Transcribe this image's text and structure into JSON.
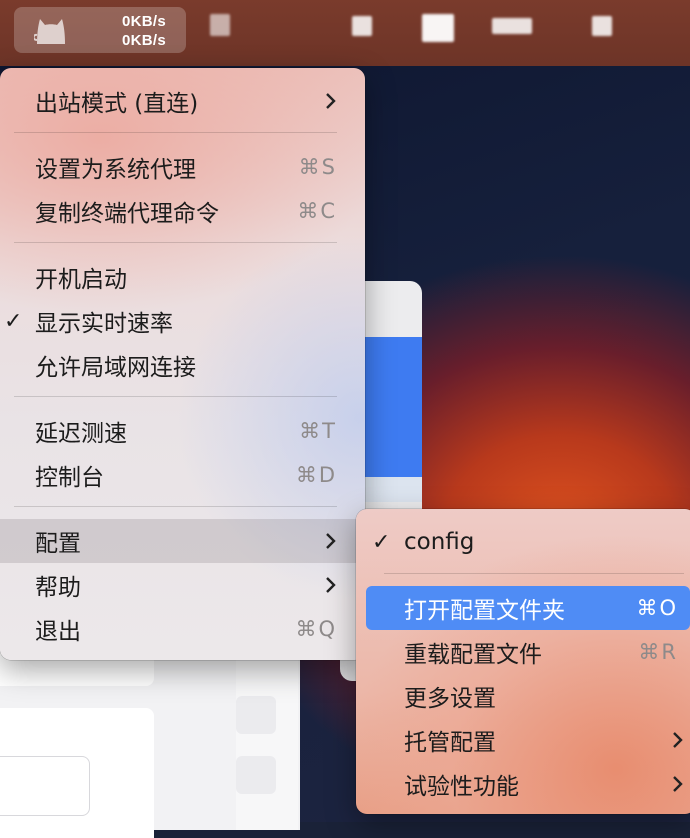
{
  "menubar": {
    "upload_speed": "0KB/s",
    "download_speed": "0KB/s"
  },
  "main_menu": {
    "items": [
      {
        "label": "出站模式 (直连)",
        "shortcut": "",
        "submenu": true
      },
      {
        "label": "设置为系统代理",
        "shortcut": "⌘S"
      },
      {
        "label": "复制终端代理命令",
        "shortcut": "⌘C"
      },
      {
        "label": "开机启动",
        "shortcut": ""
      },
      {
        "label": "显示实时速率",
        "shortcut": "",
        "checked": true,
        "check": "✓"
      },
      {
        "label": "允许局域网连接",
        "shortcut": ""
      },
      {
        "label": "延迟测速",
        "shortcut": "⌘T"
      },
      {
        "label": "控制台",
        "shortcut": "⌘D"
      },
      {
        "label": "配置",
        "shortcut": "",
        "submenu": true,
        "hovered": true
      },
      {
        "label": "帮助",
        "shortcut": "",
        "submenu": true
      },
      {
        "label": "退出",
        "shortcut": "⌘Q"
      }
    ]
  },
  "sub_menu": {
    "items": [
      {
        "label": "config",
        "checked": true,
        "check": "✓"
      },
      {
        "label": "打开配置文件夹",
        "shortcut": "⌘O",
        "highlighted": true
      },
      {
        "label": "重载配置文件",
        "shortcut": "⌘R"
      },
      {
        "label": "更多设置",
        "shortcut": ""
      },
      {
        "label": "托管配置",
        "submenu": true
      },
      {
        "label": "试验性功能",
        "submenu": true
      }
    ]
  },
  "colors": {
    "highlight": "#4f8cf5",
    "menubar": "#6d3427",
    "accent_window": "#3e7bf1"
  }
}
